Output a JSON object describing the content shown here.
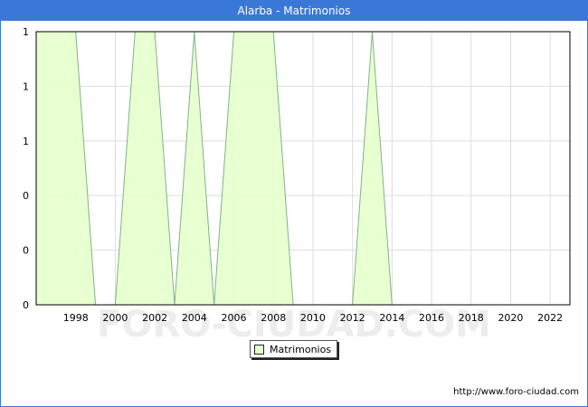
{
  "window": {
    "title": "Alarba - Matrimonios"
  },
  "footer": {
    "url": "http://www.foro-ciudad.com"
  },
  "watermark": "FORO-CIUDAD.COM",
  "colors": {
    "title_bar": "#3a78d8",
    "area_fill": "#e6ffcc",
    "area_line": "#7fb38a",
    "grid": "#dddddd"
  },
  "chart_data": {
    "type": "area",
    "title": "Alarba - Matrimonios",
    "xlabel": "",
    "ylabel": "",
    "series": [
      {
        "name": "Matrimonios",
        "x": [
          1996,
          1997,
          1998,
          1999,
          2000,
          2001,
          2002,
          2003,
          2004,
          2005,
          2006,
          2007,
          2008,
          2009,
          2010,
          2011,
          2012,
          2013,
          2014,
          2015,
          2016,
          2017,
          2018,
          2019,
          2020,
          2021,
          2022
        ],
        "values": [
          1,
          1,
          1,
          0,
          0,
          1,
          1,
          0,
          1,
          0,
          1,
          1,
          1,
          0,
          0,
          0,
          0,
          1,
          0,
          0,
          0,
          0,
          0,
          0,
          0,
          0,
          0
        ]
      }
    ],
    "x_ticks": [
      "1998",
      "2000",
      "2002",
      "2004",
      "2006",
      "2008",
      "2010",
      "2012",
      "2014",
      "2016",
      "2018",
      "2020",
      "2022"
    ],
    "y_ticks": [
      "0",
      "0",
      "0",
      "1",
      "1",
      "1"
    ],
    "xlim": [
      1996,
      2023
    ],
    "ylim": [
      0,
      1
    ],
    "grid": true,
    "legend": "bottom-center"
  }
}
